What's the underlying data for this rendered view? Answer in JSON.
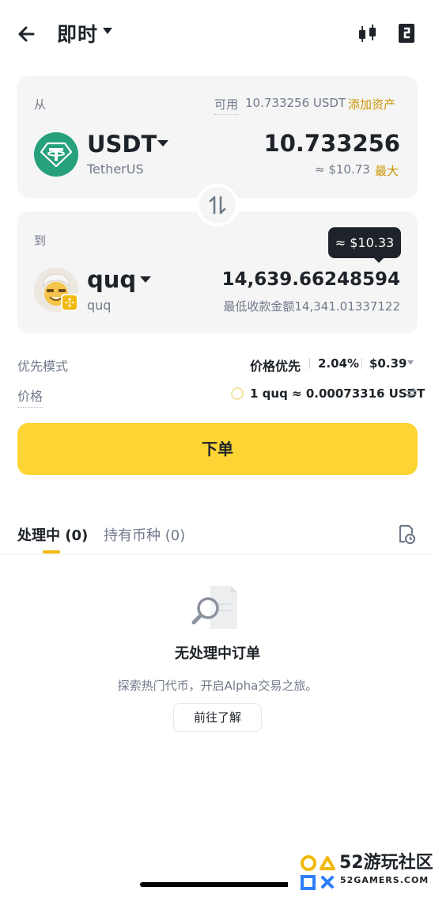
{
  "header": {
    "title": "即时"
  },
  "from": {
    "label": "从",
    "available_label": "可用",
    "available_value": "10.733256 USDT",
    "add_asset": "添加资产",
    "token": "USDT",
    "token_full": "TetherUS",
    "amount": "10.733256",
    "usd_value": "≈ $10.73",
    "max": "最大"
  },
  "to": {
    "label": "到",
    "token": "quq",
    "token_full": "quq",
    "amount": "14,639.66248594",
    "min_receive": "最低收款金额14,341.01337122",
    "tooltip": "≈ $10.33"
  },
  "details": {
    "mode_label": "优先模式",
    "mode_value": "价格优先",
    "slippage": "2.04%",
    "fee": "$0.39",
    "price_label": "价格",
    "rate": "1 quq ≈ 0.00073316 USDT"
  },
  "submit_label": "下单",
  "tabs": [
    {
      "label": "处理中 (0)",
      "active": true
    },
    {
      "label": "持有币种 (0)",
      "active": false
    }
  ],
  "empty": {
    "title": "无处理中订单",
    "description": "探索热门代币，开启Alpha交易之旅。",
    "button": "前往了解"
  },
  "watermark": {
    "name": "52游玩社区",
    "site": "52GAMERS.COM"
  },
  "colors": {
    "accent": "#fcd535",
    "link": "#c99400",
    "usdt": "#26a17b",
    "text": "#1e2329",
    "muted": "#707a8a",
    "card": "#f5f5f5"
  },
  "icons": {
    "back": "arrow-left-icon",
    "chart": "candlestick-chart-icon",
    "orders": "order-book-icon",
    "swap": "swap-vertical-icon",
    "history": "order-history-icon",
    "empty": "search-document-icon"
  }
}
